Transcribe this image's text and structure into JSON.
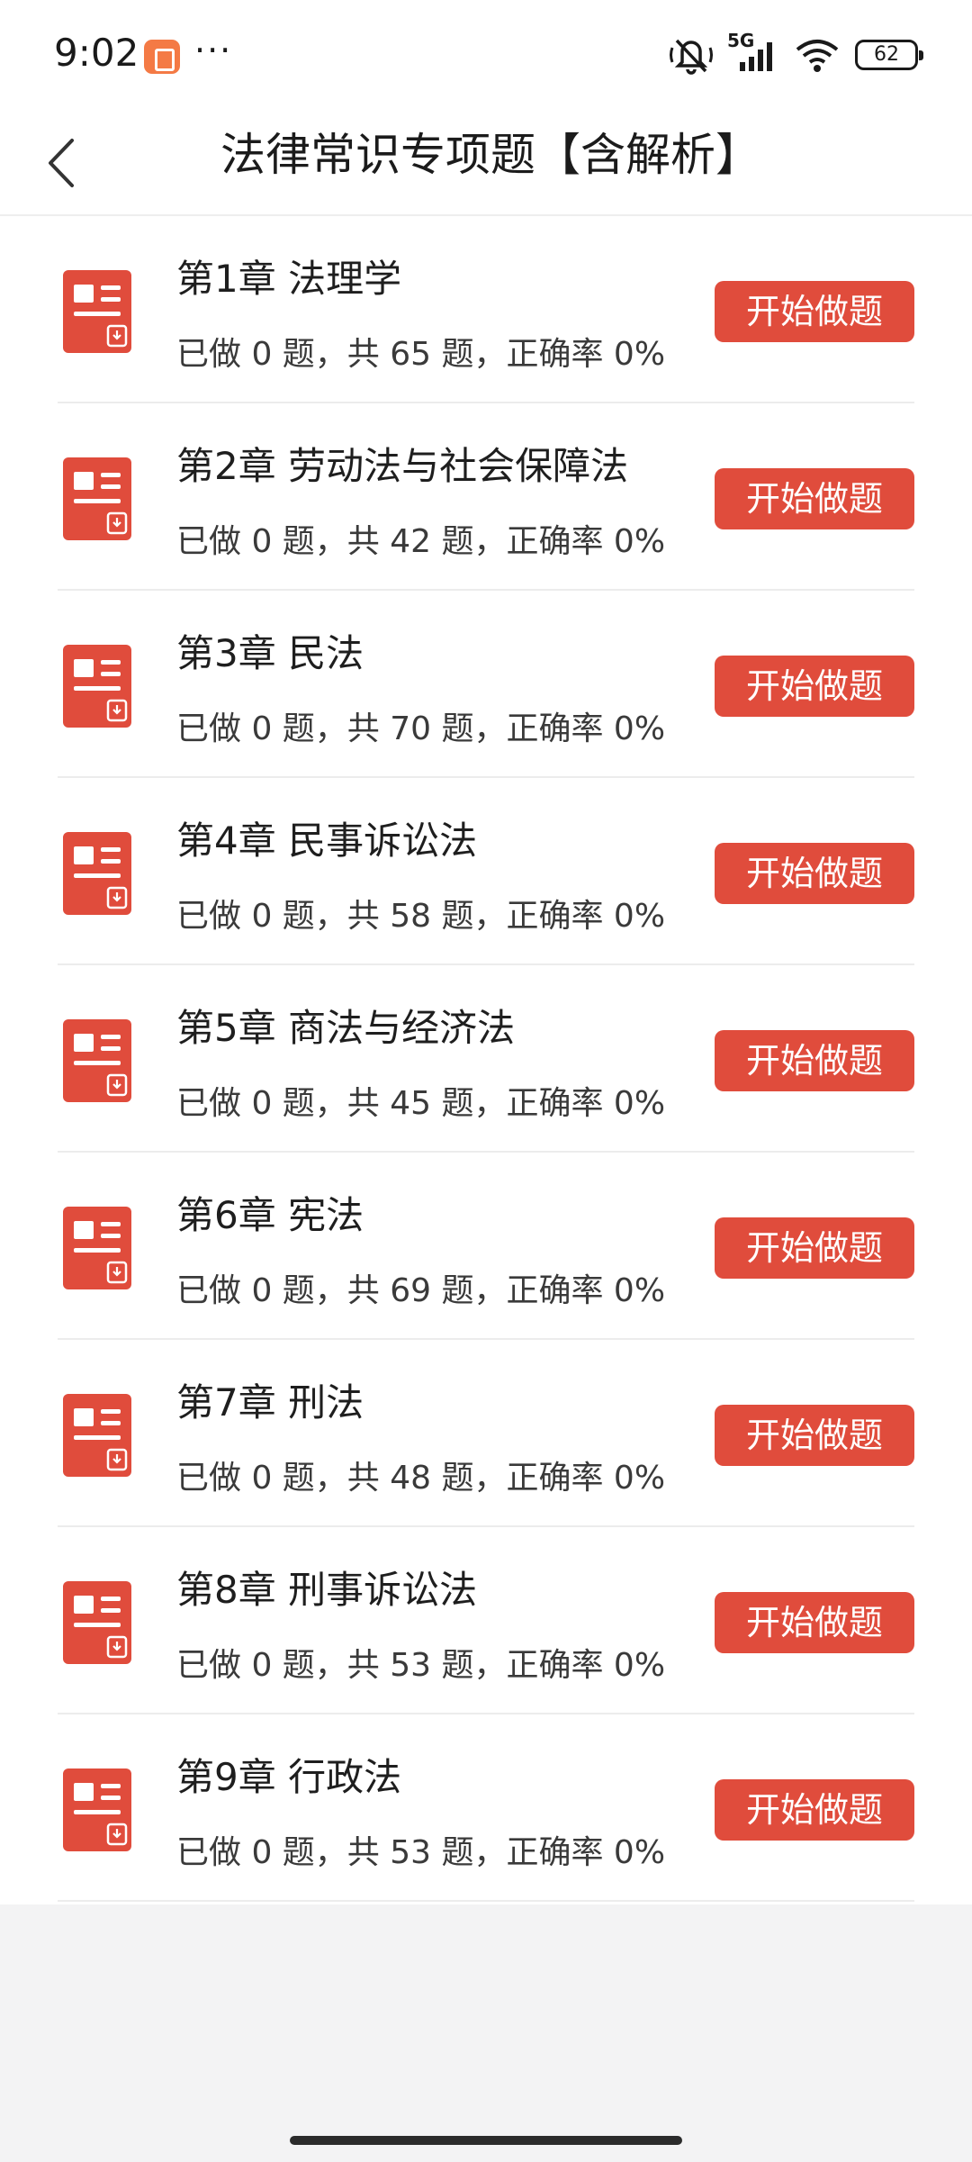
{
  "status_bar": {
    "time": "9:02",
    "more": "···",
    "network": "5G",
    "battery": "62",
    "icons": [
      "app-notification-icon",
      "mute-vibrate-icon",
      "signal-icon",
      "wifi-icon",
      "battery-icon"
    ]
  },
  "header": {
    "title": "法律常识专项题【含解析】",
    "back_icon": "chevron-left-icon"
  },
  "accent_color": "#e04c3c",
  "chapters": [
    {
      "title": "第1章 法理学",
      "stats": "已做 0 题，共 65 题，正确率 0%",
      "button": "开始做题"
    },
    {
      "title": "第2章 劳动法与社会保障法",
      "stats": "已做 0 题，共 42 题，正确率 0%",
      "button": "开始做题"
    },
    {
      "title": "第3章 民法",
      "stats": "已做 0 题，共 70 题，正确率 0%",
      "button": "开始做题"
    },
    {
      "title": "第4章 民事诉讼法",
      "stats": "已做 0 题，共 58 题，正确率 0%",
      "button": "开始做题"
    },
    {
      "title": "第5章 商法与经济法",
      "stats": "已做 0 题，共 45 题，正确率 0%",
      "button": "开始做题"
    },
    {
      "title": "第6章 宪法",
      "stats": "已做 0 题，共 69 题，正确率 0%",
      "button": "开始做题"
    },
    {
      "title": "第7章 刑法",
      "stats": "已做 0 题，共 48 题，正确率 0%",
      "button": "开始做题"
    },
    {
      "title": "第8章 刑事诉讼法",
      "stats": "已做 0 题，共 53 题，正确率 0%",
      "button": "开始做题"
    },
    {
      "title": "第9章 行政法",
      "stats": "已做 0 题，共 53 题，正确率 0%",
      "button": "开始做题"
    }
  ]
}
